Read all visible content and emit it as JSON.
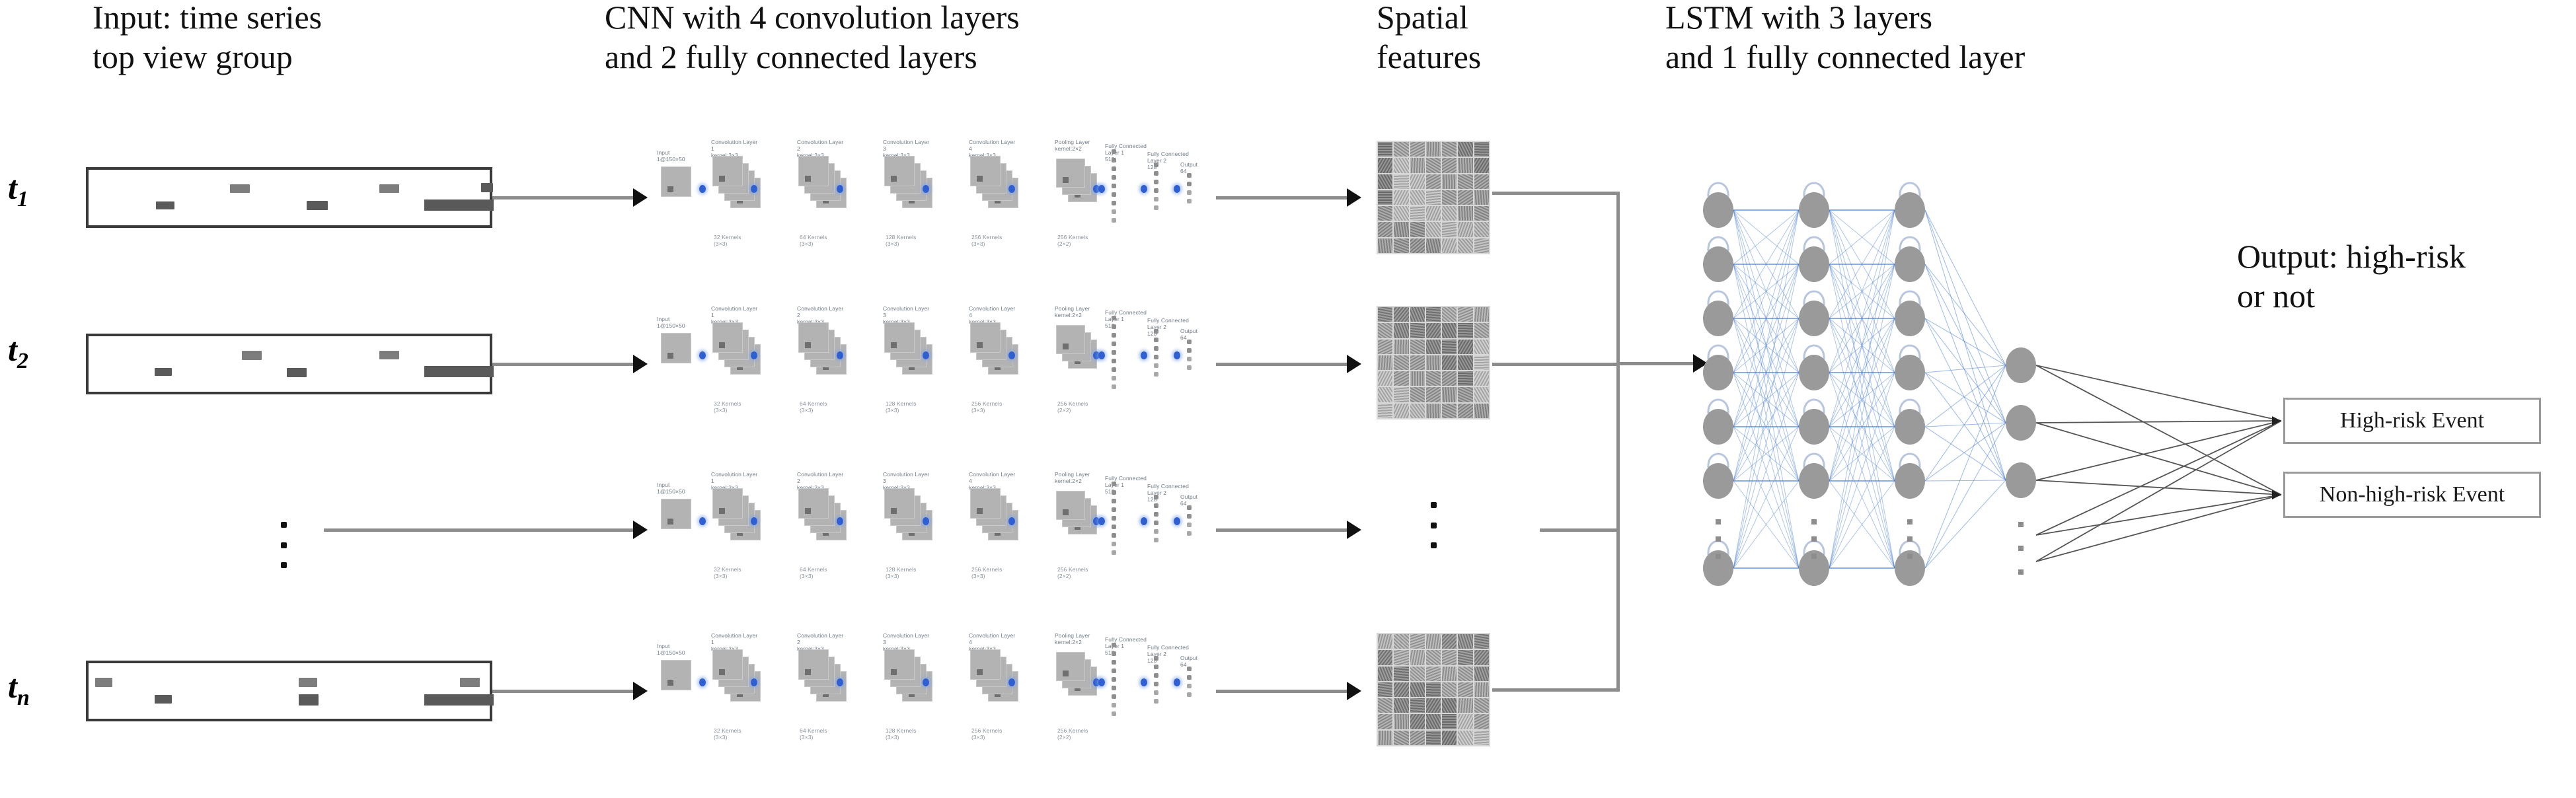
{
  "headers": {
    "input": "Input: time series\ntop view group",
    "cnn": "CNN with 4 convolution layers\nand 2 fully connected layers",
    "spatial": "Spatial\nfeatures",
    "lstm": "LSTM with 3 layers\nand 1 fully connected layer",
    "output": "Output: high-risk\nor not"
  },
  "time_steps": [
    {
      "label": "t",
      "sub": "1"
    },
    {
      "label": "t",
      "sub": "2"
    },
    {
      "label": "t",
      "sub": "n"
    }
  ],
  "cnn_layers": [
    {
      "name": "Input",
      "shape": "1@150×50",
      "kernels": ""
    },
    {
      "name": "Convolution Layer 1",
      "shape": "kernel:3×3",
      "kernels": "32 Kernels\n(3×3)"
    },
    {
      "name": "Convolution Layer 2",
      "shape": "kernel:3×3",
      "kernels": "64 Kernels\n(3×3)"
    },
    {
      "name": "Convolution Layer 3",
      "shape": "kernel:3×3",
      "kernels": "128 Kernels\n(3×3)"
    },
    {
      "name": "Convolution Layer 4",
      "shape": "kernel:3×3",
      "kernels": "256 Kernels\n(3×3)"
    },
    {
      "name": "Pooling Layer",
      "shape": "kernel:2×2",
      "kernels": "256 Kernels\n(2×2)"
    },
    {
      "name": "Fully Connected Layer 1",
      "shape": "512",
      "kernels": ""
    },
    {
      "name": "Fully Connected Layer 2",
      "shape": "128",
      "kernels": ""
    },
    {
      "name": "Output",
      "shape": "64",
      "kernels": ""
    }
  ],
  "lstm": {
    "layer_count": 3,
    "fc_layer_count": 1,
    "nodes_per_layer_visible": 7,
    "fc_nodes_visible": 3
  },
  "outputs": [
    {
      "label": "High-risk Event"
    },
    {
      "label": "Non-high-risk Event"
    }
  ],
  "colors": {
    "connection_blue": "#4a7fd4",
    "node_gray": "#9a9a9a",
    "arrow_gray": "#8c8c8c",
    "box_border": "#3a3a3a",
    "text": "#111111"
  },
  "ellipsis": "⋮"
}
